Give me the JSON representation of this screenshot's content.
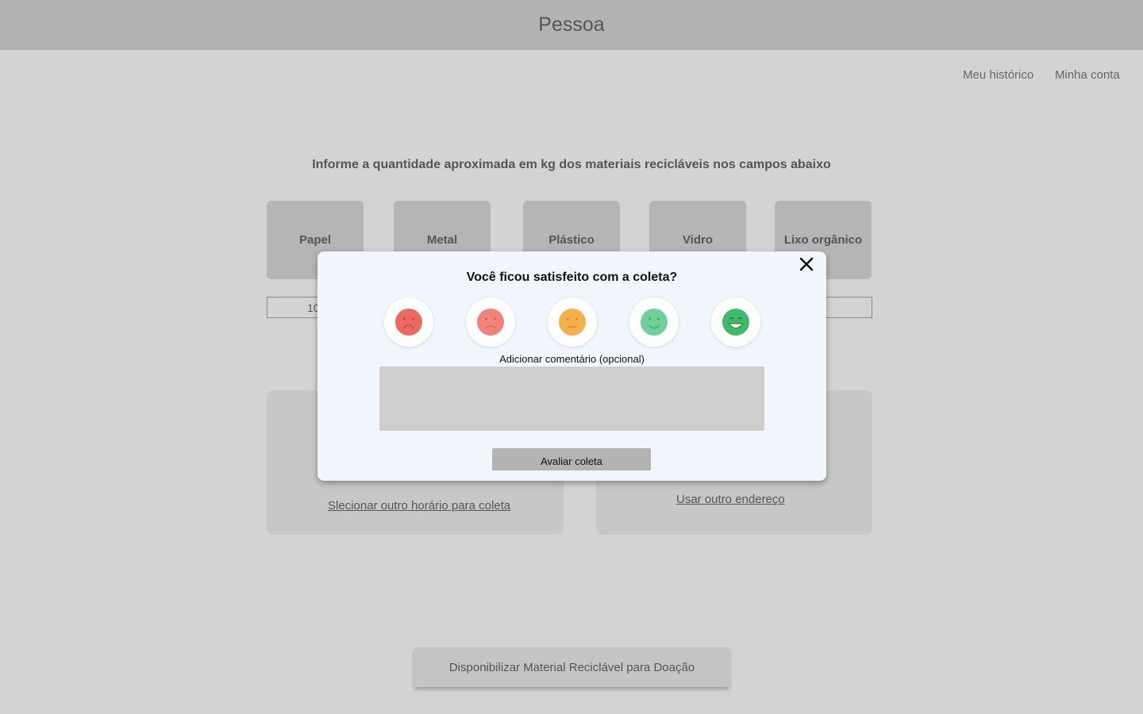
{
  "header": {
    "title": "Pessoa"
  },
  "nav": {
    "history": "Meu histórico",
    "account": "Minha conta"
  },
  "instruction": "Informe a quantidade aproximada em kg dos materiais recicláveis nos campos abaixo",
  "materials": [
    {
      "label": "Papel"
    },
    {
      "label": "Metal"
    },
    {
      "label": "Plástico"
    },
    {
      "label": "Vidro"
    },
    {
      "label": "Lixo orgânico"
    }
  ],
  "quantity_inputs": {
    "first_value": "10"
  },
  "schedule_panel": {
    "link": "Slecionar outro horário para coleta"
  },
  "address_panel": {
    "link": "Usar outro endereço"
  },
  "donate_button": "Disponibilizar Material Reciclável para Doação",
  "modal": {
    "title": "Você ficou satisfeito com a coleta?",
    "rating_icons": [
      {
        "icon": "very-sad-face-icon",
        "color": "#e86a62"
      },
      {
        "icon": "sad-face-icon",
        "color": "#f3837a"
      },
      {
        "icon": "neutral-face-icon",
        "color": "#f6b04b"
      },
      {
        "icon": "happy-face-icon",
        "color": "#6fd09a"
      },
      {
        "icon": "very-happy-face-icon",
        "color": "#3fba6a"
      }
    ],
    "comment_label": "Adicionar comentário (opcional)",
    "submit_label": "Avaliar coleta"
  }
}
